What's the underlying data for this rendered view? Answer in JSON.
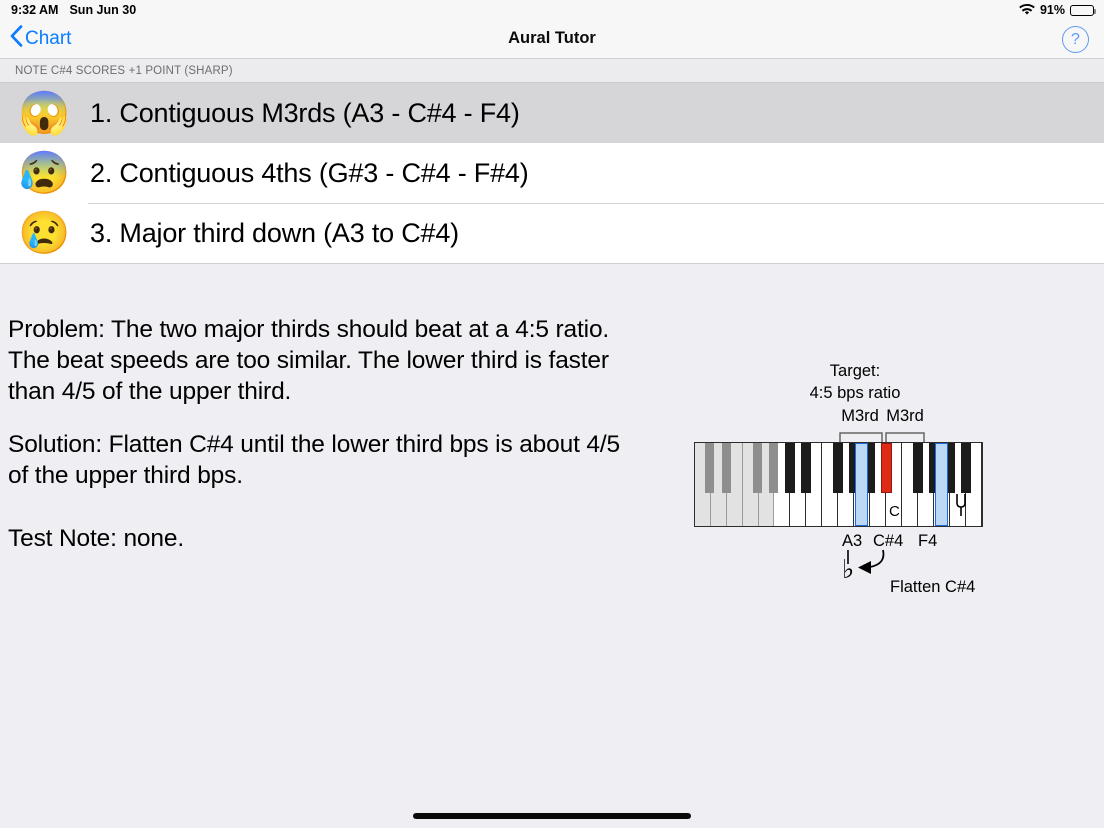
{
  "status_bar": {
    "time": "9:32 AM",
    "date": "Sun Jun 30",
    "wifi_icon": "wifi-icon",
    "battery_percent": "91%",
    "battery_level": 91,
    "battery_icon": "battery-icon"
  },
  "nav_bar": {
    "back_label": "Chart",
    "back_icon": "chevron-left-icon",
    "title": "Aural Tutor",
    "help_label": "?",
    "help_icon": "help-circle-icon",
    "accent_color": "#0a7cff"
  },
  "section_header": {
    "title": "NOTE C#4 SCORES +1 POINT (SHARP)"
  },
  "issues": [
    {
      "emoji": "😱",
      "emoji_name": "face-screaming-in-fear-emoji",
      "label": "1. Contiguous M3rds (A3 - C#4 - F4)",
      "selected": true
    },
    {
      "emoji": "😰",
      "emoji_name": "anxious-face-with-sweat-emoji",
      "label": "2. Contiguous 4ths (G#3 - C#4 - F#4)",
      "selected": false
    },
    {
      "emoji": "😢",
      "emoji_name": "crying-face-emoji",
      "label": "3. Major third down (A3 to C#4)",
      "selected": false
    }
  ],
  "explanation": {
    "problem": "Problem: The two major thirds should beat at a 4:5 ratio. The beat speeds are too similar. The lower third is faster than 4/5 of the upper third.",
    "solution": "Solution: Flatten C#4 until the lower third bps is about 4/5 of the upper third bps.",
    "test_note": "Test Note: none."
  },
  "diagram": {
    "target_line": "Target:",
    "ratio_line": "4:5 bps ratio",
    "interval_left": "M3rd",
    "interval_right": "M3rd",
    "note_a3": "A3",
    "note_cs4": "C#4",
    "note_f4": "F4",
    "key_letter_c": "C",
    "flatten_instruction": "Flatten C#4",
    "flat_symbol": "♭",
    "tuning_fork_icon": "tuning-fork-icon",
    "highlight_color": "#bdd7f7",
    "highlight_border_color": "#1c6ae0",
    "target_key_color": "#e02a18"
  }
}
